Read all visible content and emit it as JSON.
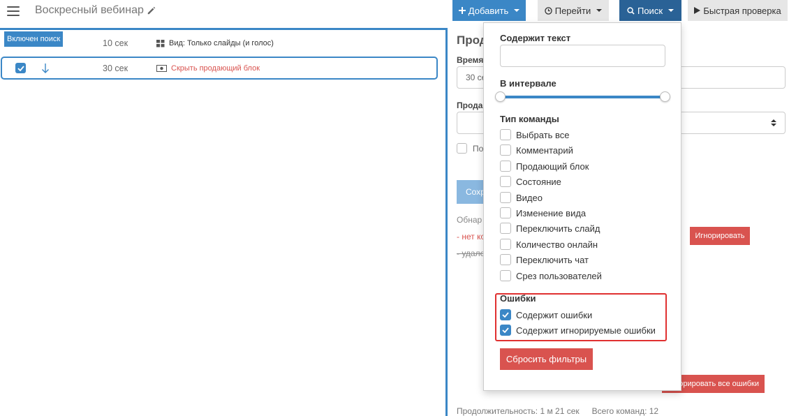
{
  "header": {
    "title": "Воскресный вебинар",
    "add_label": "Добавить",
    "goto_label": "Перейти",
    "search_label": "Поиск",
    "quick_check_label": "Быстрая проверка"
  },
  "left": {
    "search_badge": "Включен поиск",
    "rows": [
      {
        "duration": "10 сек",
        "command": "Вид: Только слайды (и голос)"
      },
      {
        "duration": "30 сек",
        "command": "Скрыть продающий блок"
      }
    ]
  },
  "right": {
    "heading": "Прод",
    "time_label": "Время",
    "time_value": "30 се",
    "sales_label": "Прода",
    "checkbox_label": "По",
    "save_label": "Сохр",
    "found_text": "Обнар",
    "error_text": "- нет ко",
    "removed_text": "- удале",
    "ignore_label": "Игнорировать",
    "ignore_all_label": "орировать все ошибки",
    "duration_text": "Продолжительность: 1 м 21 сек",
    "total_commands": "Всего команд: 12"
  },
  "dropdown": {
    "contains_text_label": "Содержит текст",
    "contains_text_value": "",
    "interval_label": "В интервале",
    "command_type_label": "Тип команды",
    "command_types": [
      "Выбрать все",
      "Комментарий",
      "Продающий блок",
      "Состояние",
      "Видео",
      "Изменение вида",
      "Переключить слайд",
      "Количество онлайн",
      "Переключить чат",
      "Срез пользователей"
    ],
    "errors_label": "Ошибки",
    "errors_options": [
      {
        "label": "Содержит ошибки",
        "checked": true
      },
      {
        "label": "Содержит игнорируемые ошибки",
        "checked": true
      }
    ],
    "reset_label": "Сбросить фильтры"
  },
  "colors": {
    "primary": "#3b87c6",
    "dark_primary": "#2a6296",
    "danger": "#d9534f",
    "highlight": "#e03030"
  }
}
